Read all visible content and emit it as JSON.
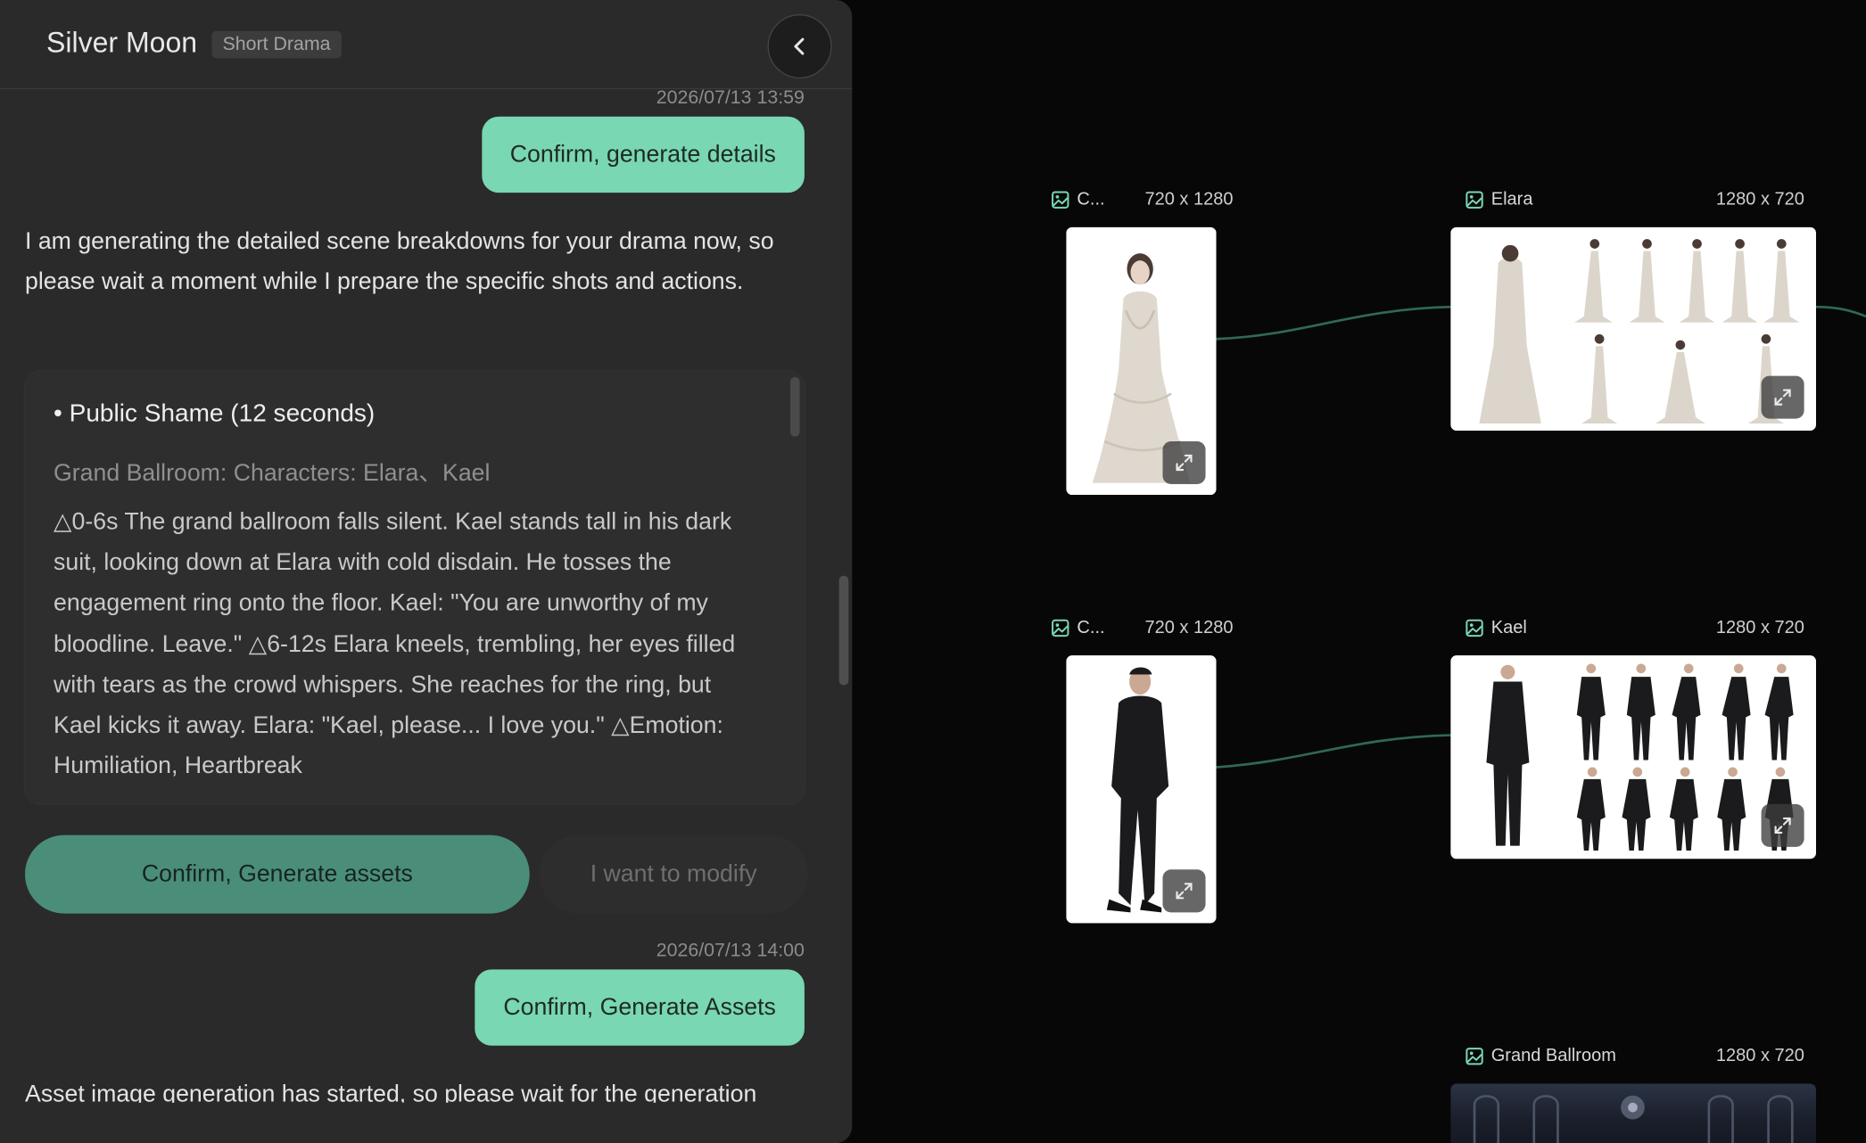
{
  "header": {
    "title": "Silver Moon",
    "tag": "Short Drama"
  },
  "messages": {
    "ts1": "2026/07/13 13:59",
    "user1": "Confirm, generate details",
    "ai1": "I am generating the detailed scene breakdowns for your drama now, so please wait a moment while I prepare the specific shots and actions.",
    "scene_title": "• Public Shame (12 seconds)",
    "scene_location": "Grand Ballroom: Characters: Elara、Kael",
    "scene_body": "△0-6s The grand ballroom falls silent. Kael stands tall in his dark suit, looking down at Elara with cold disdain. He tosses the engagement ring onto the floor. Kael: \"You are unworthy of my bloodline. Leave.\" △6-12s Elara kneels, trembling, her eyes filled with tears as the crowd whispers. She reaches for the ring, but Kael kicks it away. Elara: \"Kael, please... I love you.\" △Emotion: Humiliation, Heartbreak",
    "btn_primary": "Confirm, Generate assets",
    "btn_secondary": "I want to modify",
    "ts2": "2026/07/13 14:00",
    "user2": "Confirm, Generate Assets",
    "ai2": "Asset image generation has started, so please wait for the generation"
  },
  "canvas": {
    "nodes": [
      {
        "label": "C...",
        "dims": "720 x 1280",
        "icon": "image-icon"
      },
      {
        "label": "Elara",
        "dims": "1280 x 720",
        "icon": "image-icon"
      },
      {
        "label": "C...",
        "dims": "720 x 1280",
        "icon": "image-icon"
      },
      {
        "label": "Kael",
        "dims": "1280 x 720",
        "icon": "image-icon"
      },
      {
        "label": "Grand Ballroom",
        "dims": "1280 x 720",
        "icon": "image-icon"
      }
    ],
    "accent_color": "#79d7b3",
    "connector_color": "#3f8a72"
  }
}
